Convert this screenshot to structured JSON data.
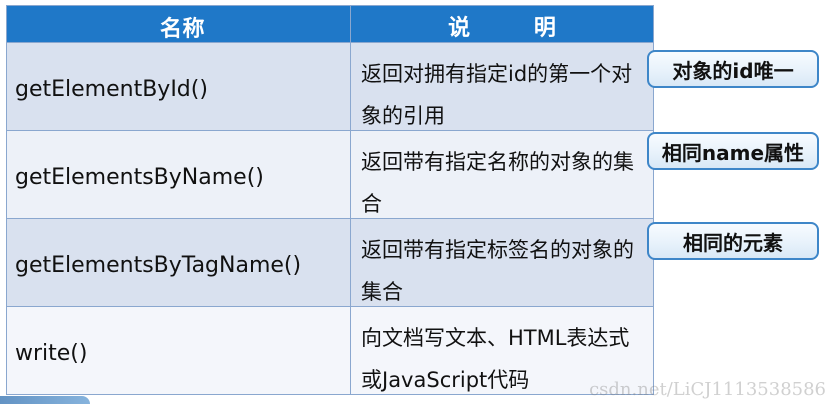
{
  "table": {
    "headers": {
      "name": "名称",
      "description": "说 明"
    },
    "rows": [
      {
        "method": "getElementById()",
        "description": "返回对拥有指定id的第一个对象的引用"
      },
      {
        "method": "getElementsByName()",
        "description": "返回带有指定名称的对象的集合"
      },
      {
        "method": "getElementsByTagName()",
        "description": "返回带有指定标签名的对象的集合"
      },
      {
        "method": "write()",
        "description": "向文档写文本、HTML表达式或JavaScript代码"
      }
    ]
  },
  "callouts": [
    "对象的id唯一",
    "相同name属性",
    "相同的元素"
  ],
  "watermark": "csdn.net/LiCJ1113538586"
}
